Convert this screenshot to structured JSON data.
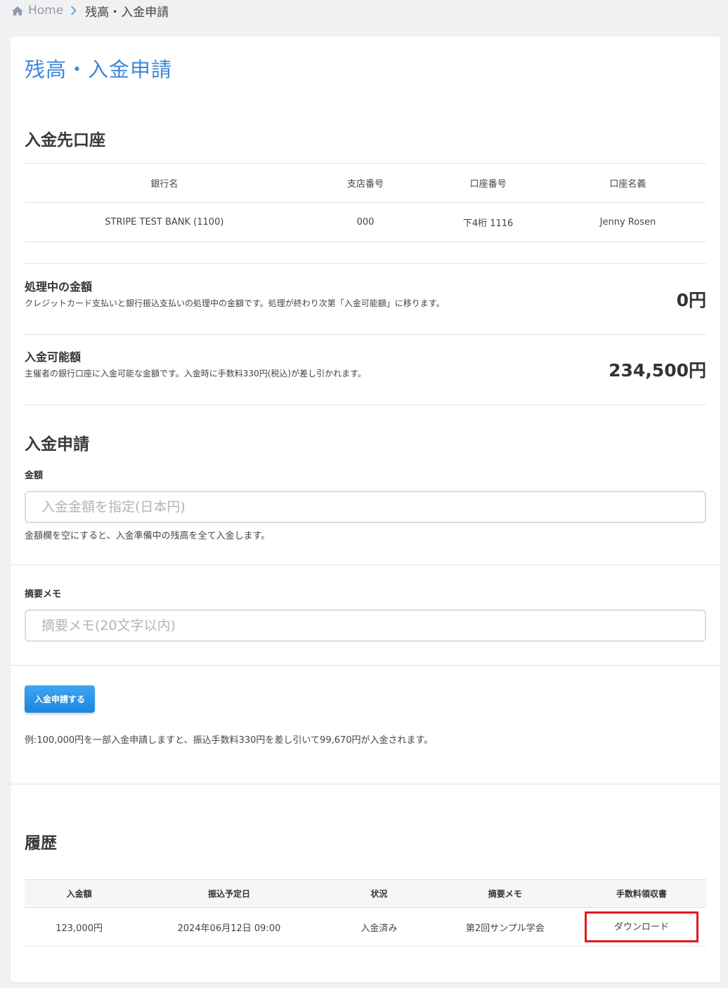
{
  "breadcrumb": {
    "home": "Home",
    "current": "残高・入金申請"
  },
  "page_title": "残高・入金申請",
  "deposit_account": {
    "title": "入金先口座",
    "columns": [
      "銀行名",
      "支店番号",
      "口座番号",
      "口座名義"
    ],
    "row": [
      "STRIPE TEST BANK (1100)",
      "000",
      "下4桁 1116",
      "Jenny Rosen"
    ]
  },
  "processing": {
    "label": "処理中の金額",
    "desc": "クレジットカード支払いと銀行振込支払いの処理中の金額です。処理が終わり次第「入金可能額」に移ります。",
    "amount": "0円"
  },
  "available": {
    "label": "入金可能額",
    "desc": "主催者の銀行口座に入金可能な金額です。入金時に手数料330円(税込)が差し引かれます。",
    "amount": "234,500円"
  },
  "request": {
    "title": "入金申請",
    "amount_label": "金額",
    "amount_placeholder": "入金金額を指定(日本円)",
    "amount_help": "金額欄を空にすると、入金準備中の残高を全て入金します。",
    "memo_label": "摘要メモ",
    "memo_placeholder": "摘要メモ(20文字以内)",
    "submit_label": "入金申請する",
    "example": "例:100,000円を一部入金申請しますと、振込手数料330円を差し引いて99,670円が入金されます。"
  },
  "history": {
    "title": "履歴",
    "columns": [
      "入金額",
      "振込予定日",
      "状況",
      "摘要メモ",
      "手数料領収書"
    ],
    "rows": [
      {
        "amount": "123,000円",
        "date": "2024年06月12日 09:00",
        "status": "入金済み",
        "memo": "第2回サンプル学会",
        "receipt": "ダウンロード"
      }
    ]
  },
  "colors": {
    "title_blue": "#3f87dc",
    "button_blue": "#2196f3",
    "highlight_red": "#e01b24"
  }
}
